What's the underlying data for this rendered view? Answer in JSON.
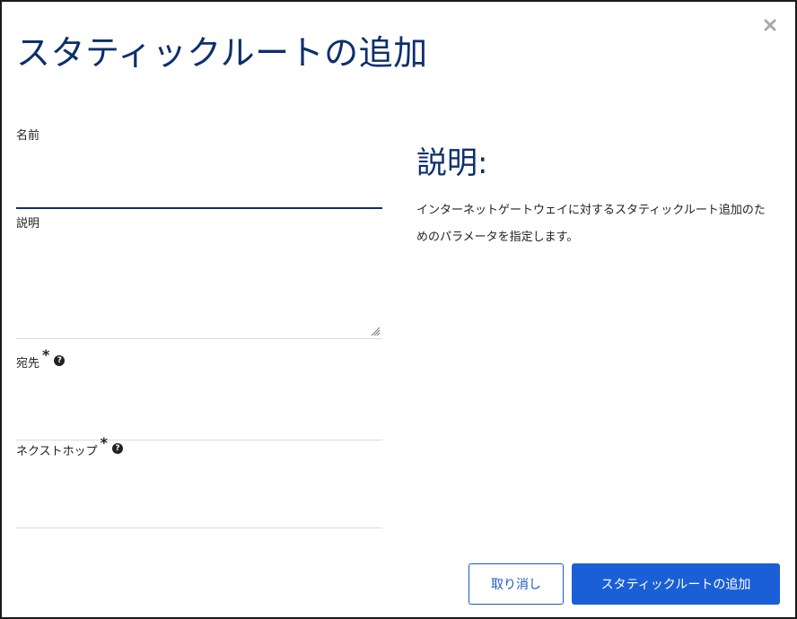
{
  "dialog": {
    "title": "スタティックルートの追加",
    "close_icon": "close-icon"
  },
  "form": {
    "name_label": "名前",
    "name_value": "",
    "description_label": "説明",
    "description_value": "",
    "destination_label": "宛先",
    "destination_value": "",
    "next_hop_label": "ネクストホップ",
    "next_hop_value": "",
    "required_mark": "*",
    "help_icon": "question-circle-icon"
  },
  "help_panel": {
    "heading": "説明:",
    "body": "インターネットゲートウェイに対するスタティックルート追加のためのパラメータを指定します。"
  },
  "buttons": {
    "cancel_label": "取り消し",
    "submit_label": "スタティックルートの追加"
  },
  "colors": {
    "title": "#0d2f6e",
    "primary": "#1a5fd6",
    "border": "#1a1a1a"
  }
}
